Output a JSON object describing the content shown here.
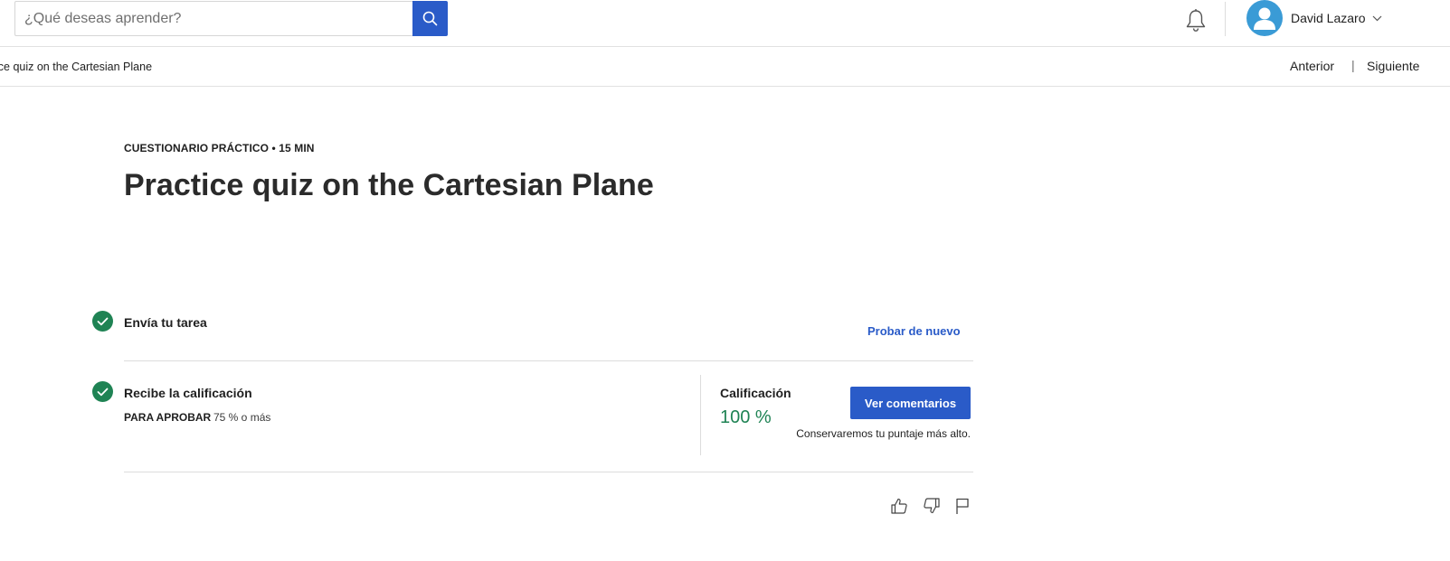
{
  "header": {
    "search_placeholder": "¿Qué deseas aprender?",
    "user_name": "David Lazaro"
  },
  "subbar": {
    "breadcrumb": "ice quiz on the Cartesian Plane",
    "prev_label": "Anterior",
    "separator": "|",
    "next_label": "Siguiente"
  },
  "main": {
    "kicker": "CUESTIONARIO PRÁCTICO • 15 MIN",
    "title": "Practice quiz on the Cartesian Plane",
    "step1": {
      "title": "Envía tu tarea",
      "action_label": "Probar de nuevo"
    },
    "step2": {
      "title": "Recibe la calificación",
      "pass_label": "PARA APROBAR",
      "pass_value": "75 % o más"
    },
    "grade": {
      "label": "Calificación",
      "value": "100 %",
      "button_label": "Ver comentarios",
      "note": "Conservaremos tu puntaje más alto."
    }
  },
  "colors": {
    "primary": "#2a5bc8",
    "success": "#1f8354",
    "avatar": "#3a9bd6"
  },
  "icons": [
    "search-icon",
    "bell-icon",
    "user-icon",
    "chevron-down-icon",
    "check-icon",
    "thumbs-up-icon",
    "thumbs-down-icon",
    "flag-icon"
  ]
}
